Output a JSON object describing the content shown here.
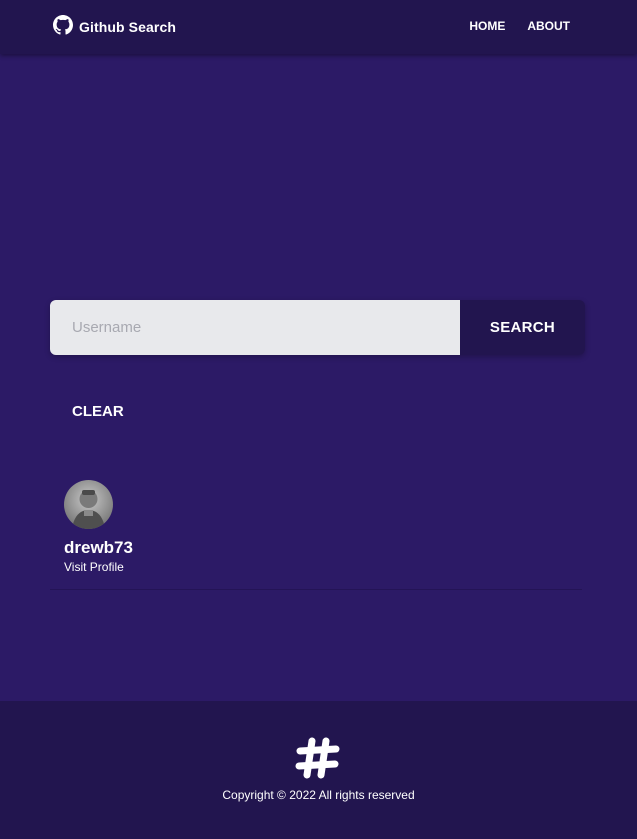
{
  "navbar": {
    "brand": "Github Search",
    "brand_icon": "github-icon",
    "links": [
      {
        "label": "HOME"
      },
      {
        "label": "ABOUT"
      }
    ]
  },
  "search": {
    "placeholder": "Username",
    "value": "",
    "button_label": "SEARCH",
    "clear_label": "CLEAR"
  },
  "results": [
    {
      "username": "drewb73",
      "link_label": "Visit Profile",
      "avatar_icon": "avatar-photo"
    }
  ],
  "footer": {
    "logo_icon": "hash-icon",
    "copyright": "Copyright © 2022 All rights reserved"
  },
  "colors": {
    "background": "#2c1a66",
    "navbar": "#22154f",
    "input_bg": "#e8e9ec",
    "text": "#ffffff"
  }
}
